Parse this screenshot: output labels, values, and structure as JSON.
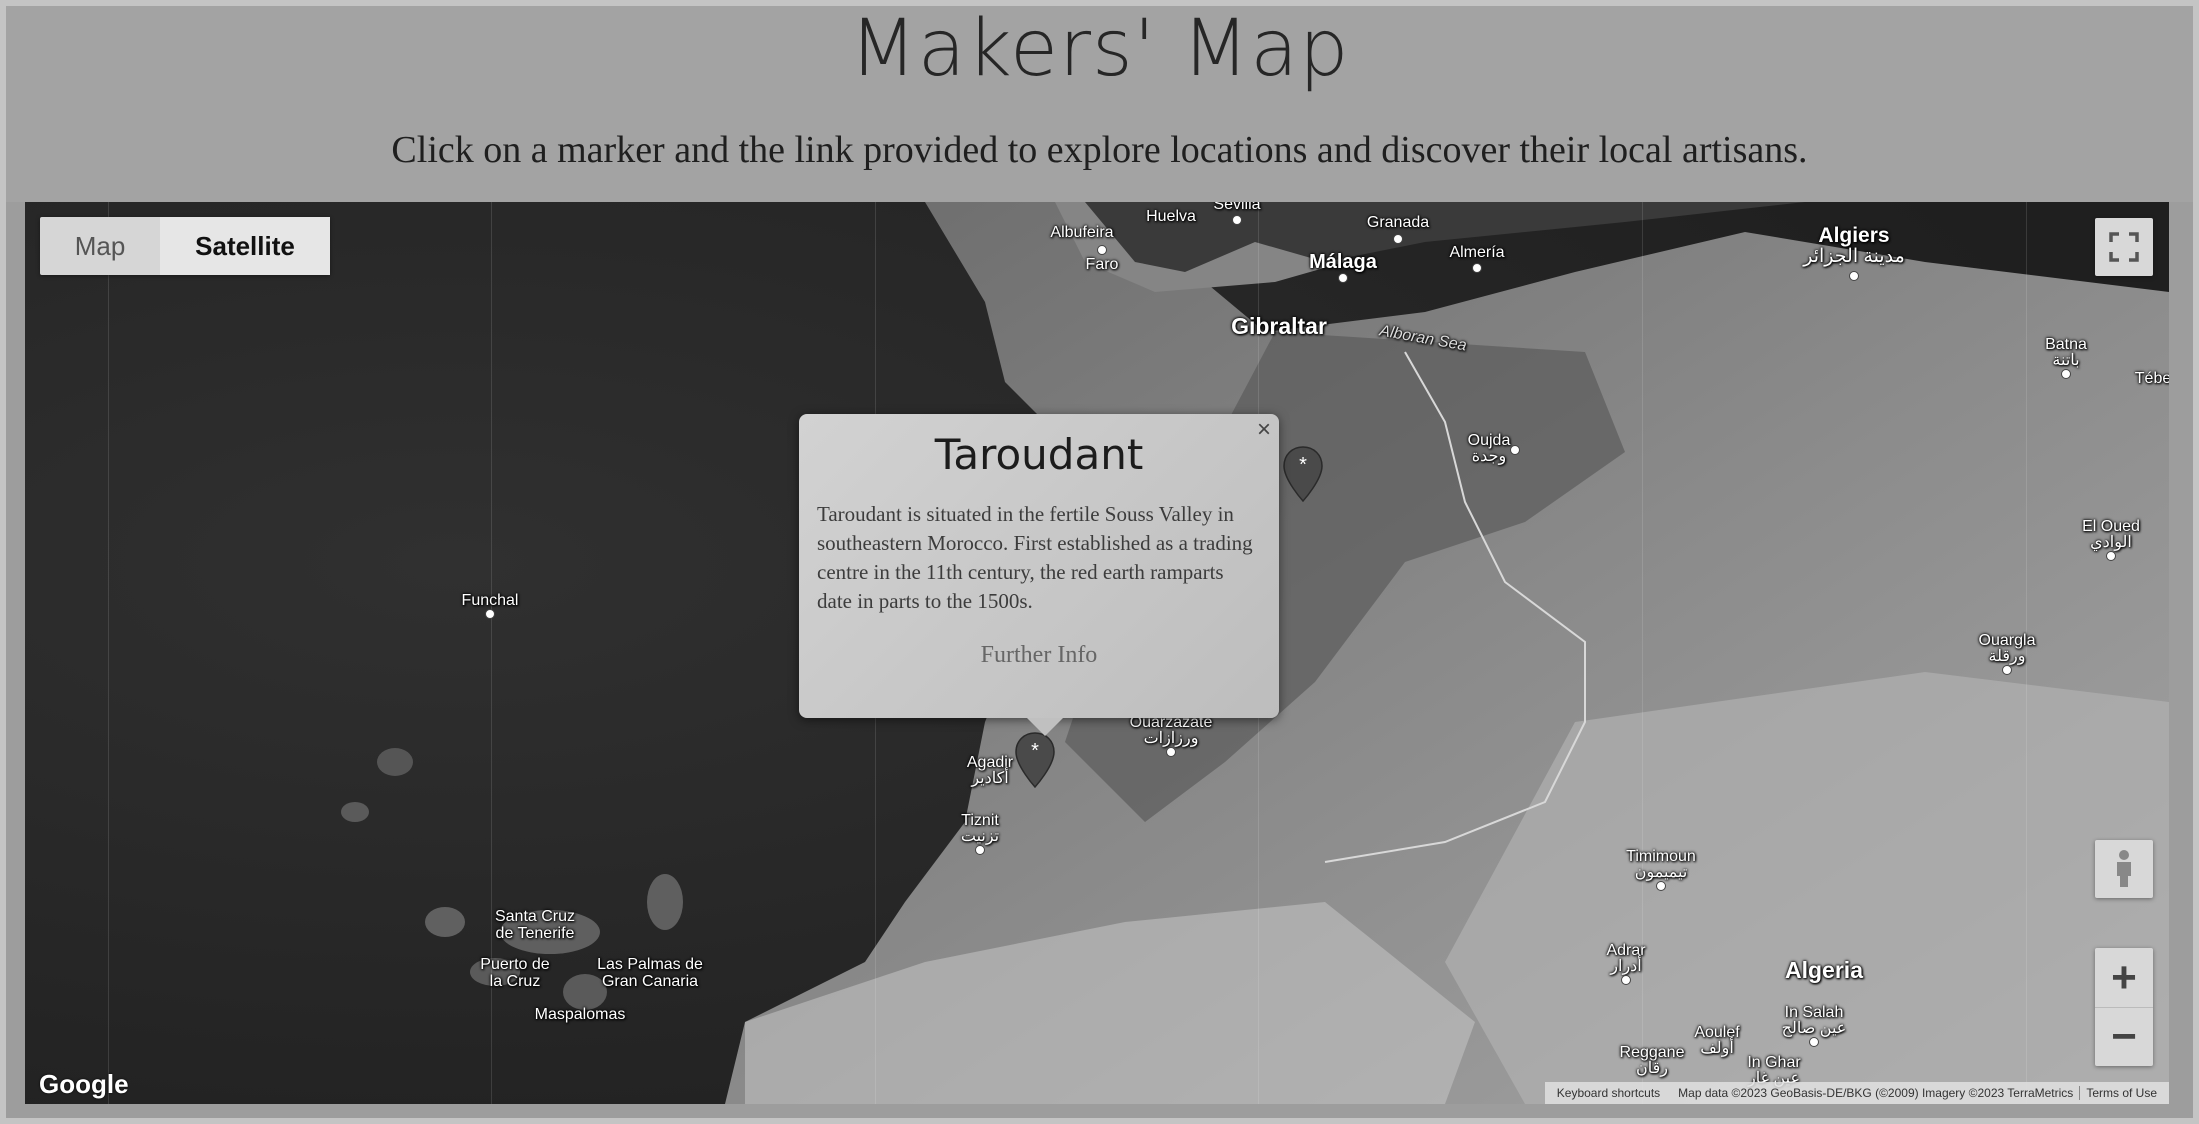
{
  "page": {
    "title": "Makers' Map",
    "subtitle": "Click on a marker and the link provided to explore locations and discover their local artisans."
  },
  "map_controls": {
    "map_label": "Map",
    "satellite_label": "Satellite",
    "active_type": "Satellite",
    "zoom_in": "+",
    "zoom_out": "−",
    "fullscreen_icon": "fullscreen-icon",
    "pegman_icon": "pegman-icon"
  },
  "popup": {
    "title": "Taroudant",
    "text": "Taroudant is situated in the fertile Souss Valley in southeastern Morocco. First established as a trading centre in the 11th century, the red earth ramparts date in parts to the 1500s.",
    "link": "Further Info",
    "close": "×"
  },
  "map_labels": {
    "albufeira": "Albufeira",
    "faro": "Faro",
    "huelva": "Huelva",
    "sevilla": "Sevilla",
    "granada": "Granada",
    "malaga": "Málaga",
    "almeria": "Almería",
    "gibraltar": "Gibraltar",
    "alboran": "Alboran Sea",
    "algiers": "Algiers",
    "algiers_ar": "مدينة الجزائر",
    "batna": "Batna",
    "batna_ar": "باتنة",
    "tebessa": "Tébe",
    "oujda": "Oujda",
    "oujda_ar": "وجدة",
    "el_oued": "El Oued",
    "el_oued_ar": "الوادي",
    "funchal": "Funchal",
    "ouargla": "Ouargla",
    "ouargla_ar": "ورقلة",
    "agadir": "Agadir",
    "agadir_ar": "أكادير",
    "ouarzazate": "Ouarzazate",
    "ouarzazate_ar": "ورزازات",
    "tiznit": "Tiznit",
    "tiznit_ar": "تزنيت",
    "timimoun": "Timimoun",
    "timimoun_ar": "تيميمون",
    "santa_cruz": "Santa Cruz\nde Tenerife",
    "puerto": "Puerto de\nla Cruz",
    "las_palmas": "Las Palmas de\nGran Canaria",
    "maspalomas": "Maspalomas",
    "adrar": "Adrar",
    "adrar_ar": "أدرار",
    "algeria": "Algeria",
    "in_salah": "In Salah",
    "in_salah_ar": "عين صالح",
    "aoulef": "Aoulef",
    "aoulef_ar": "أولف",
    "reggane": "Reggane",
    "reggane_ar": "رقان",
    "in_ghar": "In Ghar",
    "in_ghar_ar": "عين غار"
  },
  "attribution": {
    "google": "Google",
    "keyboard": "Keyboard shortcuts",
    "data": "Map data ©2023 GeoBasis-DE/BKG (©2009) Imagery ©2023 TerraMetrics",
    "terms": "Terms of Use"
  },
  "markers": [
    {
      "name": "Taroudant",
      "symbol": "*"
    },
    {
      "name": "North marker",
      "symbol": "*"
    }
  ]
}
